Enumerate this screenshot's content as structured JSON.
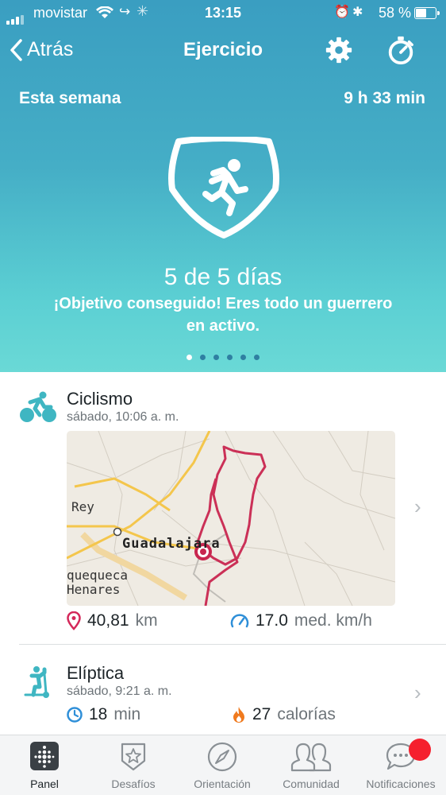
{
  "status_bar": {
    "carrier": "movistar",
    "time": "13:15",
    "battery": "58 %",
    "battery_level": 0.58
  },
  "nav": {
    "back_label": "Atrás",
    "title": "Ejercicio"
  },
  "week": {
    "label": "Esta semana",
    "total": "9 h 33 min"
  },
  "goal": {
    "progress": "5 de 5 días",
    "message_line1": "¡Objetivo conseguido! Eres todo un guerrero",
    "message_line2": "en activo.",
    "page_count": 6,
    "page_active": 1
  },
  "activities": [
    {
      "name": "Ciclismo",
      "time": "sábado, 10:06 a. m.",
      "map_labels": [
        "Rey",
        "Guadalajara",
        "quequeca",
        "Henares"
      ],
      "stat1_value": "40,81",
      "stat1_unit": "km",
      "stat2_value": "17.0",
      "stat2_unit": "med. km/h"
    },
    {
      "name": "Elíptica",
      "time": "sábado, 9:21 a. m.",
      "stat1_value": "18",
      "stat1_unit": "min",
      "stat2_value": "27",
      "stat2_unit": "calorías"
    }
  ],
  "tabs": [
    {
      "label": "Panel",
      "icon": "dashboard-icon",
      "active": true
    },
    {
      "label": "Desafíos",
      "icon": "star-badge-icon"
    },
    {
      "label": "Orientación",
      "icon": "compass-icon"
    },
    {
      "label": "Comunidad",
      "icon": "people-icon"
    },
    {
      "label": "Notificaciones",
      "icon": "chat-bubble-icon"
    }
  ],
  "colors": {
    "accent_teal": "#3fb6c2",
    "route": "#c8264f",
    "notif": "#f5202e"
  }
}
